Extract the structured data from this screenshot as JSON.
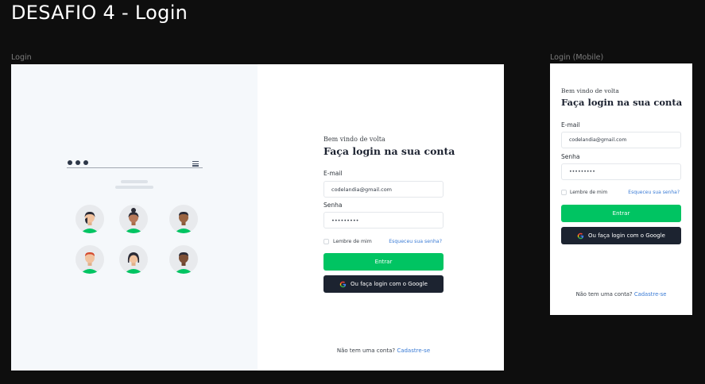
{
  "page": {
    "title": "DESAFIO 4 - Login"
  },
  "desktop": {
    "frame_label": "Login",
    "form": {
      "welcome": "Bem vindo de volta",
      "heading": "Faça login na sua conta",
      "email_label": "E-mail",
      "email_value": "codelandia@gmail.com",
      "password_label": "Senha",
      "password_value": "•••••••••",
      "remember_label": "Lembre de mim",
      "forgot_link": "Esqueceu sua senha?",
      "submit_label": "Entrar",
      "google_label": "Ou faça login com o Google",
      "signup_prompt": "Não tem uma conta?",
      "signup_link": "Cadastre-se"
    }
  },
  "mobile": {
    "frame_label": "Login (Mobile)",
    "form": {
      "welcome": "Bem vindo de volta",
      "heading": "Faça login na sua conta",
      "email_label": "E-mail",
      "email_value": "codelandia@gmail.com",
      "password_label": "Senha",
      "password_value": "•••••••••",
      "remember_label": "Lembre de mim",
      "forgot_link": "Esqueceu sua senha?",
      "submit_label": "Entrar",
      "google_label": "Ou faça login com o Google",
      "signup_prompt": "Não tem uma conta?",
      "signup_link": "Cadastre-se"
    }
  },
  "icons": {
    "google": "google-icon",
    "menu": "hamburger-menu-icon",
    "avatar": "user-avatar-icon"
  },
  "colors": {
    "background": "#0e0e0e",
    "primary_button": "#00c462",
    "google_button": "#1c2330",
    "link": "#3a7bd5",
    "illustration_panel": "#f5f8fb"
  }
}
